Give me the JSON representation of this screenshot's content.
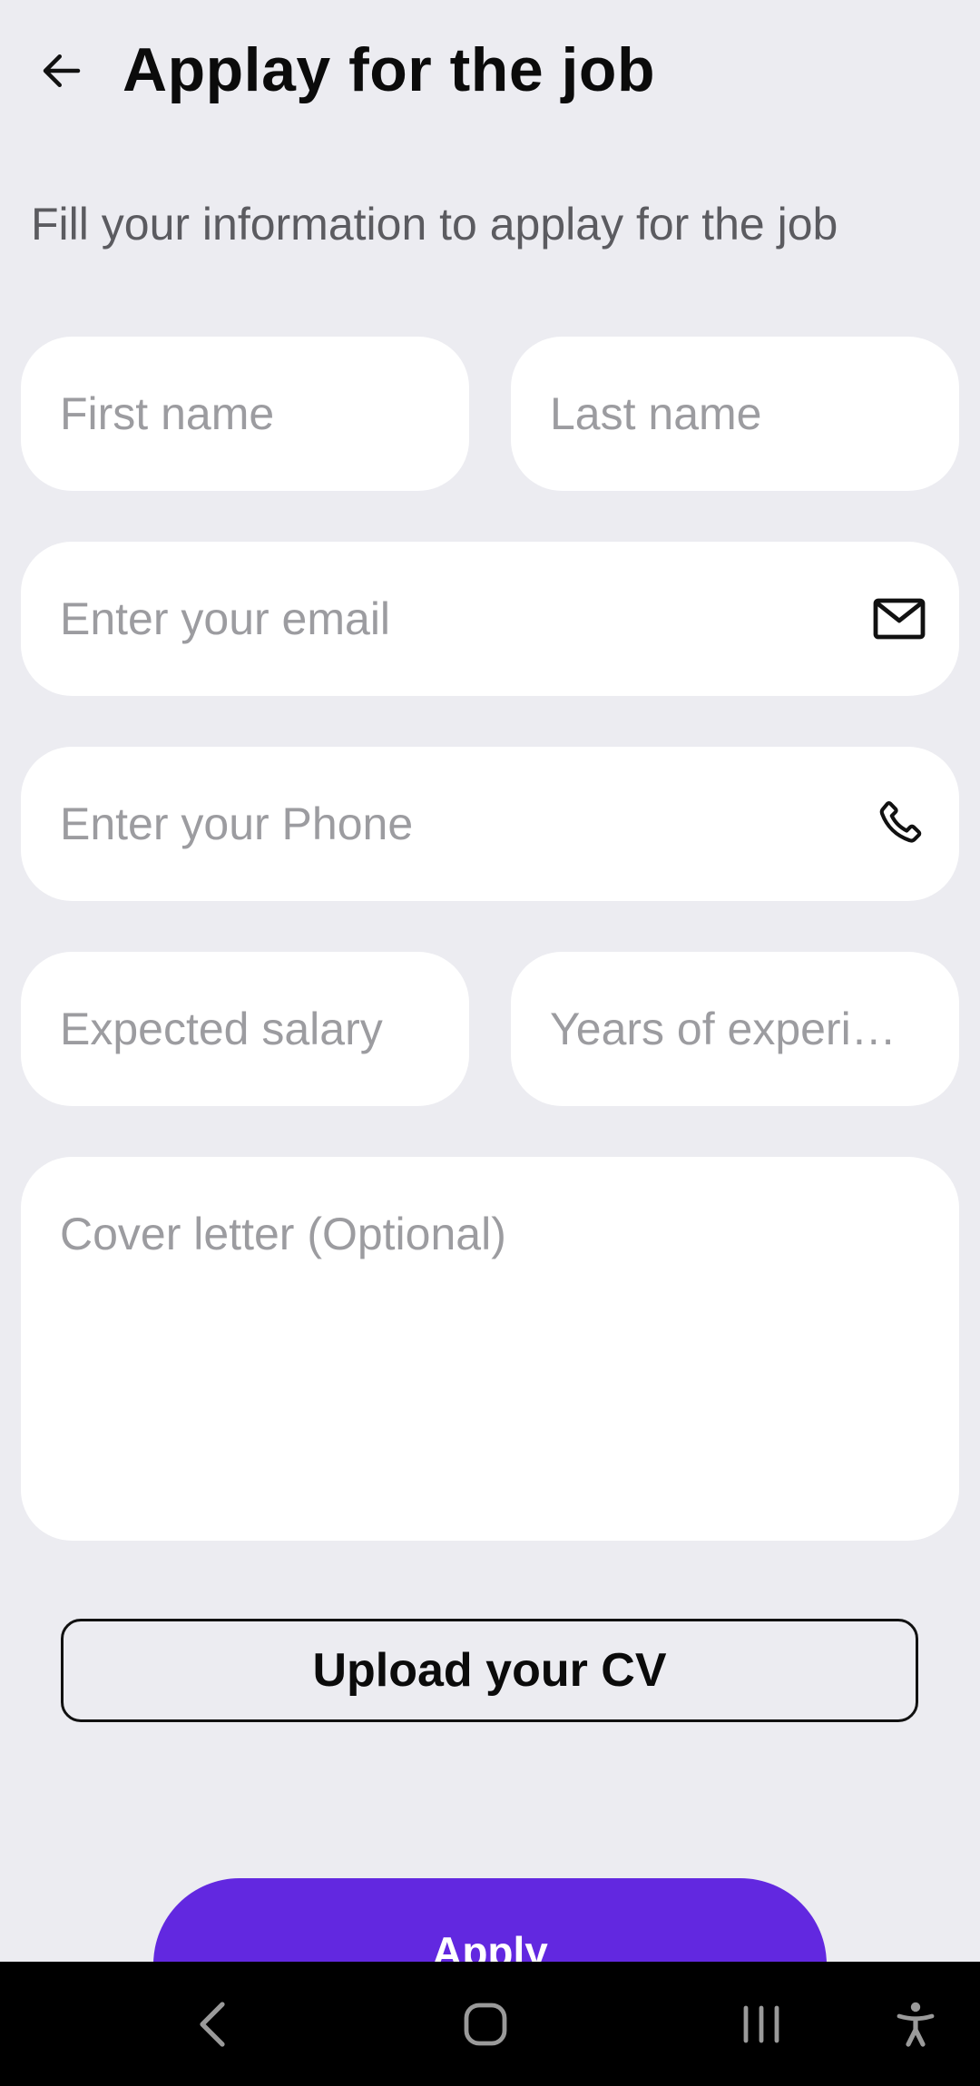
{
  "header": {
    "title": "Applay for the job",
    "back_icon": "arrow-left-icon"
  },
  "subtitle": "Fill your information to applay for the job",
  "form": {
    "first_name_placeholder": "First name",
    "last_name_placeholder": "Last name",
    "email_placeholder": "Enter your email",
    "email_icon": "mail-icon",
    "phone_placeholder": "Enter your Phone",
    "phone_icon": "phone-icon",
    "salary_placeholder": "Expected salary",
    "years_placeholder": "Years of experi…",
    "cover_placeholder": "Cover letter (Optional)"
  },
  "buttons": {
    "upload_label": "Upload your CV",
    "apply_label": "Apply"
  },
  "colors": {
    "background": "#ECECF1",
    "field": "#FFFFFF",
    "accent": "#6228E0",
    "placeholder": "#9C9CA0"
  },
  "system_nav": {
    "back_icon": "nav-back-icon",
    "home_icon": "nav-home-icon",
    "recent_icon": "nav-recent-apps-icon",
    "accessibility_icon": "accessibility-icon"
  }
}
